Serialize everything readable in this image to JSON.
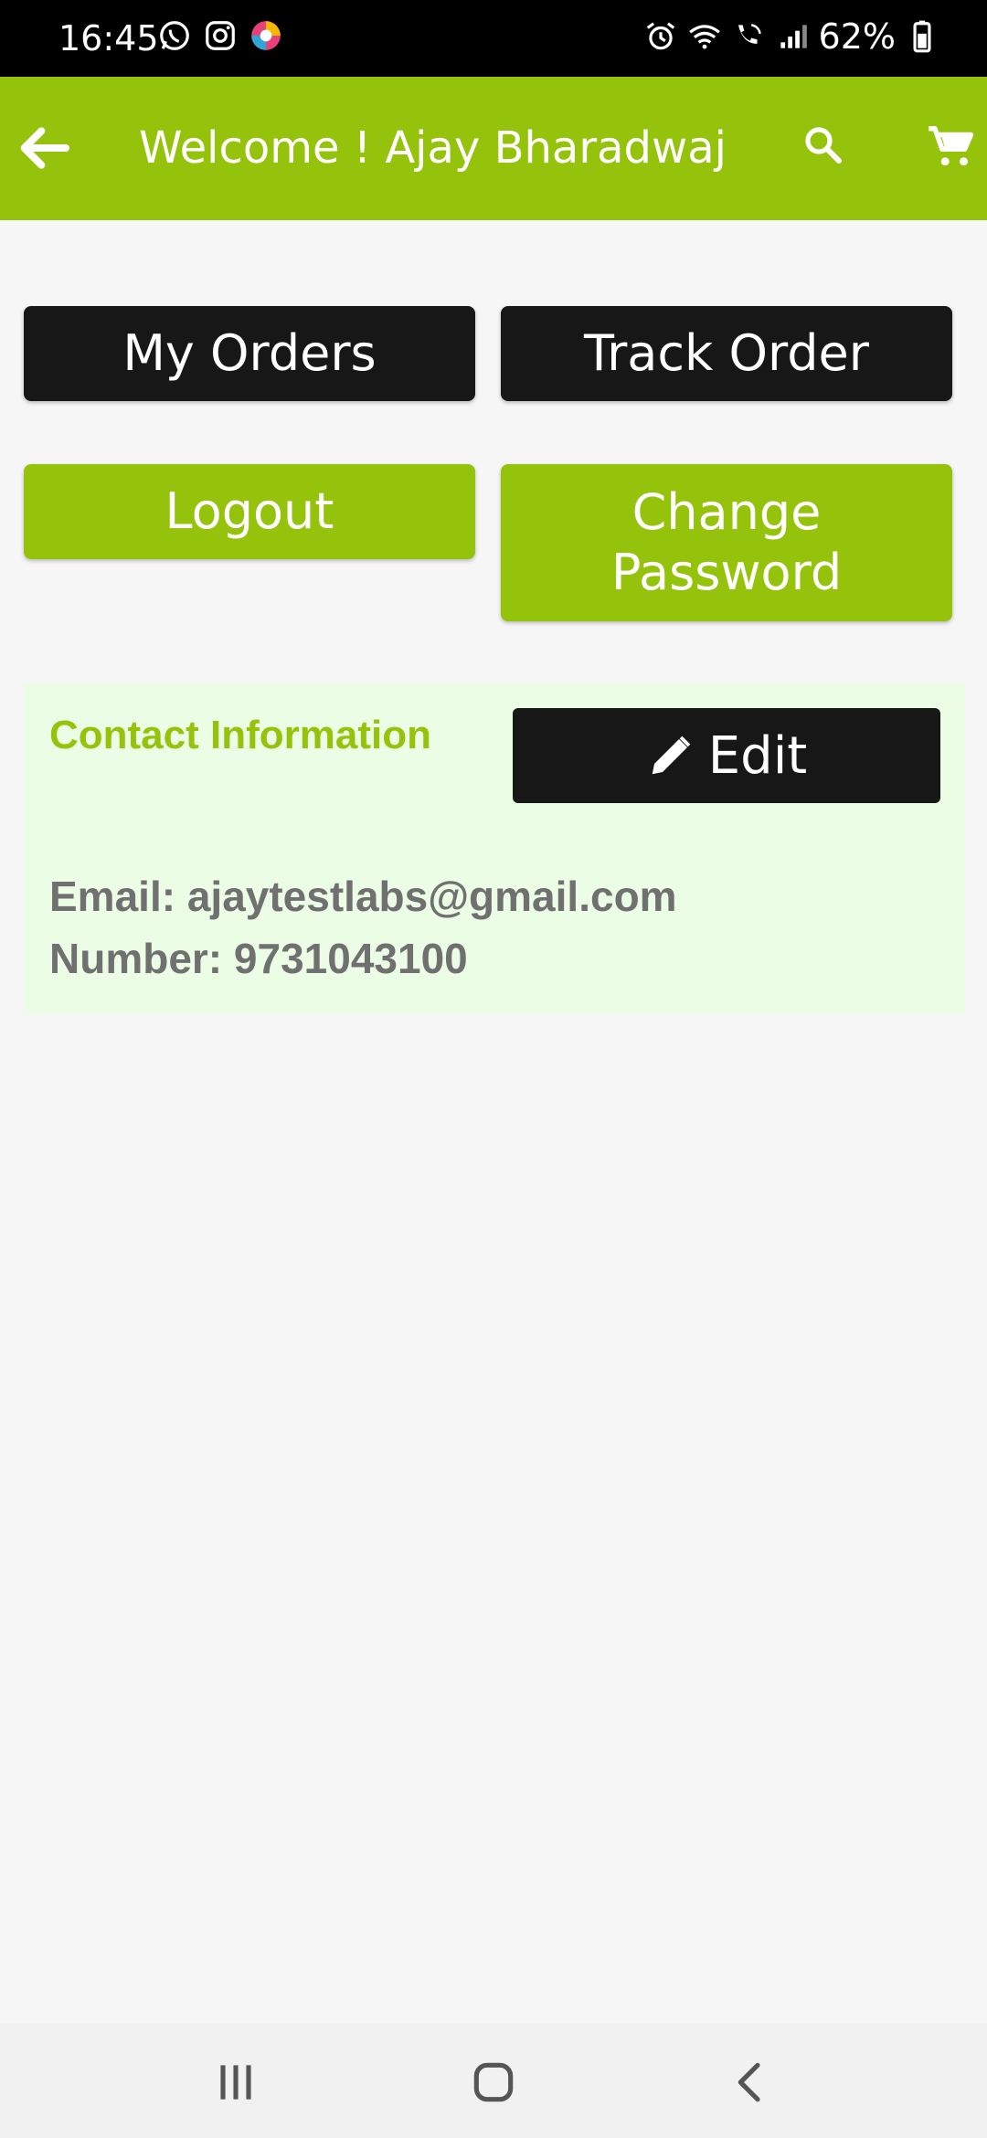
{
  "status_bar": {
    "time": "16:45",
    "left_icons": [
      "whatsapp-icon",
      "instagram-icon",
      "chrome-colorful-icon"
    ],
    "right_icons": [
      "alarm-icon",
      "wifi-icon",
      "wifi-calling-icon",
      "signal-icon",
      "battery-icon"
    ],
    "battery_percent": "62%"
  },
  "app_bar": {
    "title": "Welcome ! Ajay Bharadwaj",
    "background_color": "#95c30b"
  },
  "actions": {
    "my_orders": "My Orders",
    "track_order": "Track Order",
    "logout": "Logout",
    "change_password_line1": "Change",
    "change_password_line2": "Password"
  },
  "contact": {
    "title": "Contact Information",
    "edit_label": "Edit",
    "email_line": "Email: ajaytestlabs@gmail.com",
    "number_line": "Number: 9731043100"
  },
  "nav_bar": {
    "icons": [
      "recent-apps-icon",
      "home-icon",
      "back-nav-icon"
    ]
  }
}
